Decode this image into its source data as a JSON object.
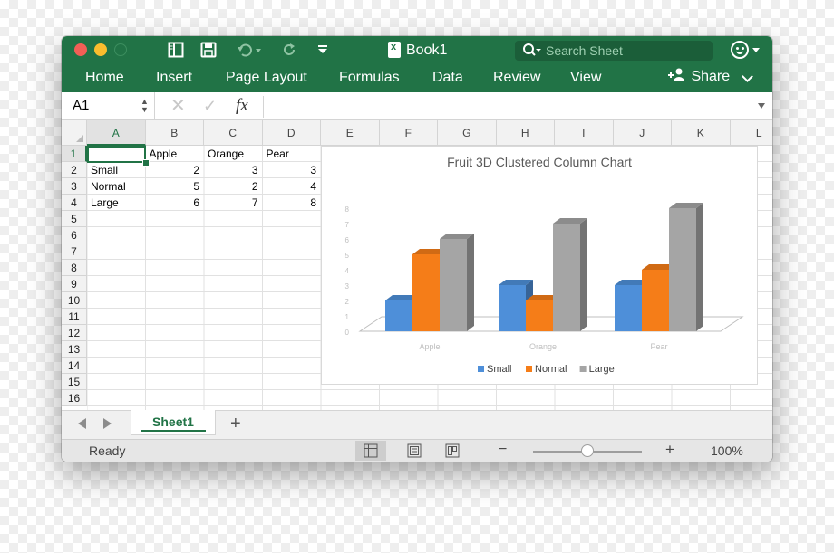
{
  "window": {
    "title": "Book1",
    "search_placeholder": "Search Sheet",
    "toolbar_icons": [
      "sidebar-icon",
      "save-icon",
      "undo-icon",
      "redo-icon",
      "customize-icon"
    ]
  },
  "ribbon": {
    "tabs": [
      "Home",
      "Insert",
      "Page Layout",
      "Formulas",
      "Data",
      "Review",
      "View"
    ],
    "share_label": "Share"
  },
  "formula_bar": {
    "name_box": "A1",
    "fx_label": "fx",
    "formula": ""
  },
  "sheet": {
    "columns": [
      "A",
      "B",
      "C",
      "D",
      "E",
      "F",
      "G",
      "H",
      "I",
      "J",
      "K",
      "L"
    ],
    "rows": [
      "1",
      "2",
      "3",
      "4",
      "5",
      "6",
      "7",
      "8",
      "9",
      "10",
      "11",
      "12",
      "13",
      "14",
      "15",
      "16"
    ],
    "selected_cell": "A1",
    "cells": [
      [
        "",
        "Apple",
        "Orange",
        "Pear"
      ],
      [
        "Small",
        "2",
        "3",
        "3"
      ],
      [
        "Normal",
        "5",
        "2",
        "4"
      ],
      [
        "Large",
        "6",
        "7",
        "8"
      ]
    ]
  },
  "chart_data": {
    "type": "bar",
    "title": "Fruit 3D Clustered Column Chart",
    "categories": [
      "Apple",
      "Orange",
      "Pear"
    ],
    "series": [
      {
        "name": "Small",
        "values": [
          2,
          3,
          3
        ],
        "color": "#4e8fd9"
      },
      {
        "name": "Normal",
        "values": [
          5,
          2,
          4
        ],
        "color": "#f57d18"
      },
      {
        "name": "Large",
        "values": [
          6,
          7,
          8
        ],
        "color": "#a5a5a5"
      }
    ],
    "yticks": [
      "0",
      "1",
      "2",
      "3",
      "4",
      "5",
      "6",
      "7",
      "8"
    ],
    "ylim": [
      0,
      8
    ],
    "legend": "bottom",
    "grid": false,
    "style": "3d-clustered-column"
  },
  "sheet_tabs": {
    "tabs": [
      "Sheet1"
    ],
    "active": "Sheet1",
    "add_label": "+"
  },
  "status_bar": {
    "status": "Ready",
    "zoom_minus": "−",
    "zoom_plus": "+",
    "zoom_level": "100%",
    "zoom_fraction": 0.5
  },
  "colors": {
    "accent": "#217346",
    "selection": "#217346"
  }
}
